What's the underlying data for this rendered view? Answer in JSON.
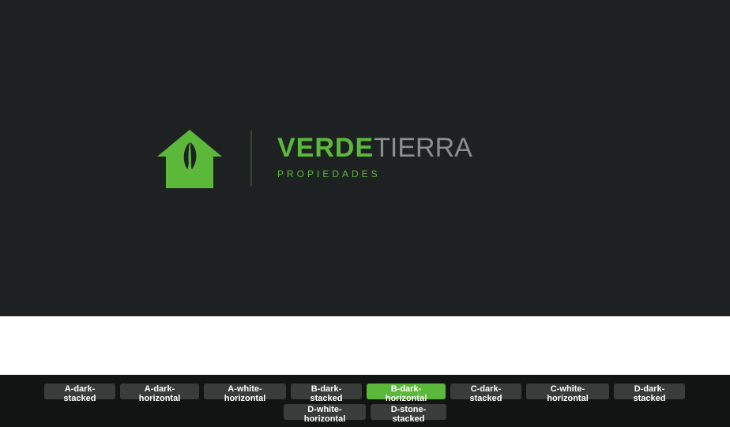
{
  "brand": {
    "name_primary": "VERDE",
    "name_secondary": "TIERRA",
    "tagline": "PROPIEDADES"
  },
  "colors": {
    "stage_background": "#1e2121",
    "accent_green": "#5cb83a",
    "secondary_gray": "#8d8f8f",
    "toolbar_background": "#121313",
    "button_background": "#3a3c3c",
    "button_active": "#5cb83a"
  },
  "icons": {
    "logo": "house-with-leaf-icon"
  },
  "variants": {
    "active": "B-dark-horizontal",
    "items": [
      {
        "line1": "A-dark-",
        "line2": "stacked"
      },
      {
        "line1": "A-dark-",
        "line2": "horizontal"
      },
      {
        "line1": "A-white-",
        "line2": "horizontal"
      },
      {
        "line1": "B-dark-",
        "line2": "stacked"
      },
      {
        "line1": "B-dark-",
        "line2": "horizontal"
      },
      {
        "line1": "C-dark-",
        "line2": "stacked"
      },
      {
        "line1": "C-white-",
        "line2": "horizontal"
      },
      {
        "line1": "D-dark-",
        "line2": "stacked"
      },
      {
        "line1": "D-white-",
        "line2": "horizontal"
      },
      {
        "line1": "D-stone-",
        "line2": "stacked"
      }
    ]
  }
}
